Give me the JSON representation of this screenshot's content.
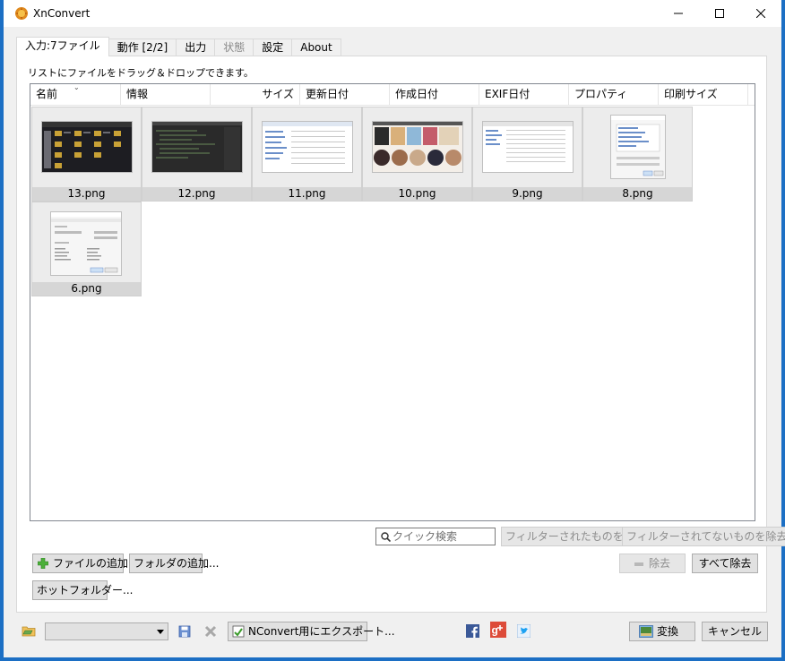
{
  "window": {
    "title": "XnConvert"
  },
  "tabs": [
    {
      "label": "入力:7ファイル"
    },
    {
      "label": "動作 [2/2]"
    },
    {
      "label": "出力"
    },
    {
      "label": "状態"
    },
    {
      "label": "設定"
    },
    {
      "label": "About"
    }
  ],
  "input": {
    "hint": "リストにファイルをドラッグ＆ドロップできます。",
    "columns": [
      "名前",
      "情報",
      "サイズ",
      "更新日付",
      "作成日付",
      "EXIF日付",
      "プロパティ",
      "印刷サイズ"
    ],
    "files": [
      {
        "name": "13.png"
      },
      {
        "name": "12.png"
      },
      {
        "name": "11.png"
      },
      {
        "name": "10.png"
      },
      {
        "name": "9.png"
      },
      {
        "name": "8.png"
      },
      {
        "name": "6.png"
      }
    ],
    "search_placeholder": "クイック検索",
    "remove_filtered": "フィルターされたものを除去",
    "remove_unfiltered": "フィルターされてないものを除去",
    "add_files": "ファイルの追加...",
    "add_folder": "フォルダの追加...",
    "hot_folder": "ホットフォルダー...",
    "remove": "除去",
    "remove_all": "すべて除去"
  },
  "footer": {
    "export_label": "NConvert用にエクスポート...",
    "convert_label": "変換",
    "cancel_label": "キャンセル",
    "preset_value": ""
  },
  "colors": {
    "desktop": "#1c6fc4",
    "window_bg": "#f0f0f0",
    "facebook": "#3b5998",
    "googleplus": "#dd4b39",
    "twitter": "#1da1f2"
  }
}
